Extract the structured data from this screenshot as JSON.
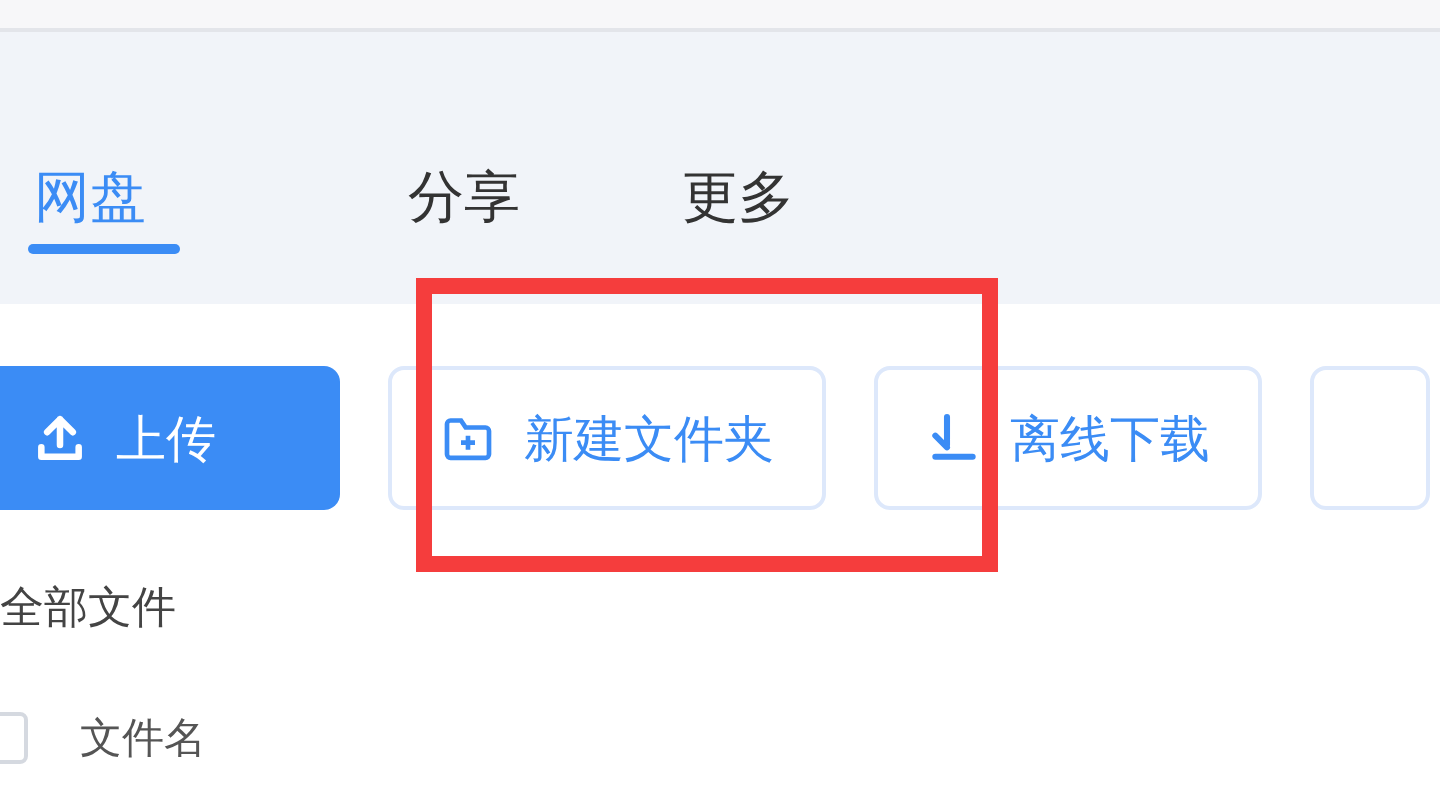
{
  "tabs": [
    {
      "label": "网盘",
      "selected": true
    },
    {
      "label": "分享",
      "selected": false
    },
    {
      "label": "更多",
      "selected": false
    }
  ],
  "toolbar": [
    {
      "kind": "upload",
      "label": "上传"
    },
    {
      "kind": "new-folder",
      "label": "新建文件夹"
    },
    {
      "kind": "download",
      "label": "离线下载"
    },
    {
      "kind": "more"
    }
  ],
  "breadcrumb": "全部文件",
  "table": {
    "select_all_checked": false,
    "columns": [
      "文件名"
    ]
  },
  "annotation": {
    "kind": "highlight"
  }
}
